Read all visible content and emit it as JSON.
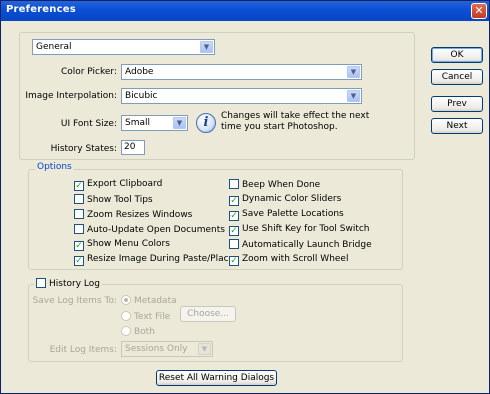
{
  "window": {
    "title": "Preferences",
    "close_glyph": "✕"
  },
  "icons": {
    "checkmark": "✓",
    "dropdown": "▼",
    "info": "i"
  },
  "section_select": {
    "value": "General"
  },
  "fields": {
    "color_picker": {
      "label": "Color Picker:",
      "value": "Adobe"
    },
    "image_interpolation": {
      "label": "Image Interpolation:",
      "value": "Bicubic"
    },
    "ui_font_size": {
      "label": "UI Font Size:",
      "value": "Small"
    },
    "font_note_line1": "Changes will take effect the next",
    "font_note_line2": "time you start Photoshop.",
    "history_states": {
      "label": "History States:",
      "value": "20"
    }
  },
  "options": {
    "legend": "Options",
    "left": [
      {
        "label": "Export Clipboard",
        "checked": true
      },
      {
        "label": "Show Tool Tips",
        "checked": false
      },
      {
        "label": "Zoom Resizes Windows",
        "checked": false
      },
      {
        "label": "Auto-Update Open Documents",
        "checked": false
      },
      {
        "label": "Show Menu Colors",
        "checked": true
      },
      {
        "label": "Resize Image During Paste/Place",
        "checked": true
      }
    ],
    "right": [
      {
        "label": "Beep When Done",
        "checked": false
      },
      {
        "label": "Dynamic Color Sliders",
        "checked": true
      },
      {
        "label": "Save Palette Locations",
        "checked": true
      },
      {
        "label": "Use Shift Key for Tool Switch",
        "checked": true
      },
      {
        "label": "Automatically Launch Bridge",
        "checked": false
      },
      {
        "label": "Zoom with Scroll Wheel",
        "checked": true
      }
    ]
  },
  "history_log": {
    "label": "History Log",
    "checked": false,
    "save_to_label": "Save Log Items To:",
    "radio_metadata": "Metadata",
    "radio_text_file": "Text File",
    "choose_button": "Choose...",
    "radio_both": "Both",
    "edit_items_label": "Edit Log Items:",
    "edit_items_value": "Sessions Only"
  },
  "reset_button": "Reset All Warning Dialogs",
  "buttons": {
    "ok": "OK",
    "cancel": "Cancel",
    "prev": "Prev",
    "next": "Next"
  }
}
